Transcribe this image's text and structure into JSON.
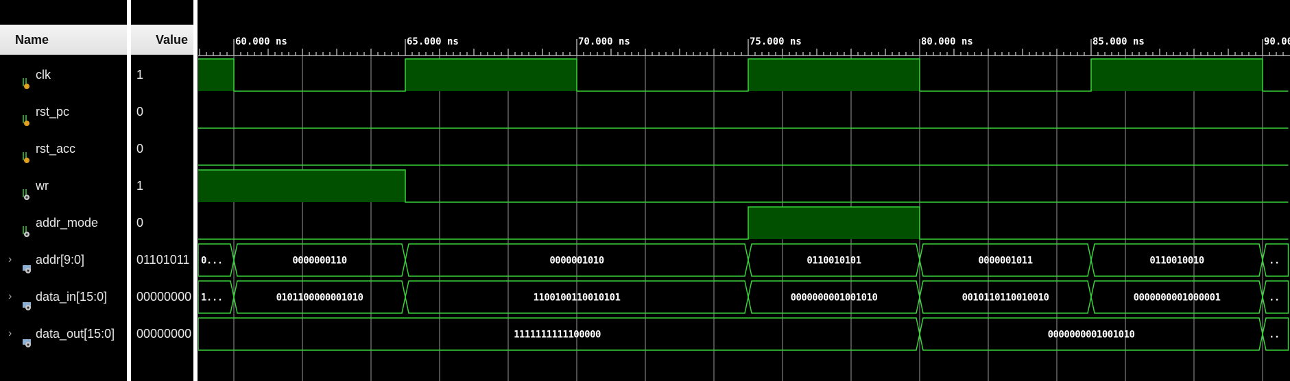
{
  "header": {
    "name_label": "Name",
    "value_label": "Value"
  },
  "colors": {
    "wave": "#3ad23a",
    "fill": "#005000",
    "grid": "#bfbfbf",
    "text": "#ffffff",
    "background": "#000000"
  },
  "timeline": {
    "unit": "ns",
    "view_range": [
      58.96,
      90.75
    ],
    "labels": [
      {
        "t": 60,
        "text": "60.000 ns"
      },
      {
        "t": 65,
        "text": "65.000 ns"
      },
      {
        "t": 70,
        "text": "70.000 ns"
      },
      {
        "t": 75,
        "text": "75.000 ns"
      },
      {
        "t": 80,
        "text": "80.000 ns"
      },
      {
        "t": 85,
        "text": "85.000 ns"
      },
      {
        "t": 90,
        "text": "90.000 ns"
      }
    ],
    "grid_step": 2
  },
  "signals": [
    {
      "name": "clk",
      "value": "1",
      "kind": "bit",
      "icon": "input-bit-icon",
      "changes": [
        [
          58.96,
          1
        ],
        [
          60,
          0
        ],
        [
          65,
          1
        ],
        [
          70,
          0
        ],
        [
          75,
          1
        ],
        [
          80,
          0
        ],
        [
          85,
          1
        ],
        [
          90,
          0
        ]
      ]
    },
    {
      "name": "rst_pc",
      "value": "0",
      "kind": "bit",
      "icon": "input-bit-icon",
      "changes": [
        [
          58.96,
          0
        ]
      ]
    },
    {
      "name": "rst_acc",
      "value": "0",
      "kind": "bit",
      "icon": "input-bit-icon",
      "changes": [
        [
          58.96,
          0
        ]
      ]
    },
    {
      "name": "wr",
      "value": "1",
      "kind": "bit",
      "icon": "output-bit-icon",
      "changes": [
        [
          58.96,
          1
        ],
        [
          65,
          0
        ]
      ]
    },
    {
      "name": "addr_mode",
      "value": "0",
      "kind": "bit",
      "icon": "output-bit-icon",
      "changes": [
        [
          58.96,
          0
        ],
        [
          75,
          1
        ],
        [
          80,
          0
        ]
      ]
    },
    {
      "name": "addr[9:0]",
      "value": "01101011",
      "kind": "bus",
      "icon": "bus-icon",
      "changes": [
        [
          58.96,
          "0..."
        ],
        [
          60,
          "0000000110"
        ],
        [
          65,
          "0000001010"
        ],
        [
          75,
          "0110010101"
        ],
        [
          80,
          "0000001011"
        ],
        [
          85,
          "0110010010"
        ],
        [
          90,
          ".."
        ]
      ]
    },
    {
      "name": "data_in[15:0]",
      "value": "00000000",
      "kind": "bus",
      "icon": "bus-icon",
      "changes": [
        [
          58.96,
          "1..."
        ],
        [
          60,
          "0101100000001010"
        ],
        [
          65,
          "1100100110010101"
        ],
        [
          75,
          "0000000001001010"
        ],
        [
          80,
          "0010110110010010"
        ],
        [
          85,
          "0000000001000001"
        ],
        [
          90,
          ".."
        ]
      ]
    },
    {
      "name": "data_out[15:0]",
      "value": "00000000",
      "kind": "bus",
      "icon": "bus-icon",
      "changes": [
        [
          58.96,
          "1111111111100000"
        ],
        [
          80,
          "0000000001001010"
        ],
        [
          90,
          ".."
        ]
      ]
    }
  ]
}
